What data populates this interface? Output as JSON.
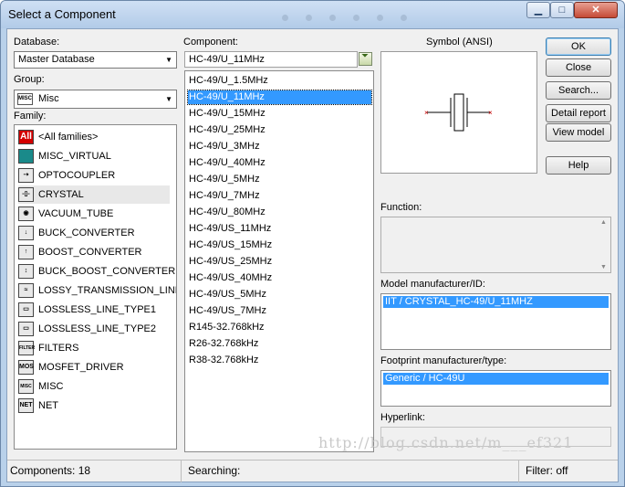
{
  "window": {
    "title": "Select a Component"
  },
  "database": {
    "label": "Database:",
    "value": "Master Database"
  },
  "group": {
    "label": "Group:",
    "value": "Misc",
    "icon_text": "MISC"
  },
  "family": {
    "label": "Family:",
    "items": [
      {
        "label": "<All families>",
        "icon": "all-families-icon",
        "icon_text": "All",
        "icon_color": "#d40000"
      },
      {
        "label": "MISC_VIRTUAL",
        "icon": "misc-virtual-icon",
        "icon_text": "",
        "icon_color": "#1a8a8a"
      },
      {
        "label": "OPTOCOUPLER",
        "icon": "optocoupler-icon",
        "icon_text": "⇢",
        "icon_color": "#e8e8e8"
      },
      {
        "label": "CRYSTAL",
        "icon": "crystal-icon",
        "icon_text": "-▯-",
        "icon_color": "#e8e8e8"
      },
      {
        "label": "VACUUM_TUBE",
        "icon": "vacuum-tube-icon",
        "icon_text": "◉",
        "icon_color": "#e8e8e8"
      },
      {
        "label": "BUCK_CONVERTER",
        "icon": "buck-converter-icon",
        "icon_text": "↓",
        "icon_color": "#e8e8e8"
      },
      {
        "label": "BOOST_CONVERTER",
        "icon": "boost-converter-icon",
        "icon_text": "↑",
        "icon_color": "#e8e8e8"
      },
      {
        "label": "BUCK_BOOST_CONVERTER",
        "icon": "buck-boost-converter-icon",
        "icon_text": "↕",
        "icon_color": "#e8e8e8"
      },
      {
        "label": "LOSSY_TRANSMISSION_LINE",
        "icon": "lossy-transmission-line-icon",
        "icon_text": "≈",
        "icon_color": "#e8e8e8"
      },
      {
        "label": "LOSSLESS_LINE_TYPE1",
        "icon": "lossless-line-type1-icon",
        "icon_text": "▭",
        "icon_color": "#e8e8e8"
      },
      {
        "label": "LOSSLESS_LINE_TYPE2",
        "icon": "lossless-line-type2-icon",
        "icon_text": "▭",
        "icon_color": "#e8e8e8"
      },
      {
        "label": "FILTERS",
        "icon": "filters-icon",
        "icon_text": "FILTER",
        "icon_color": "#e8e8e8"
      },
      {
        "label": "MOSFET_DRIVER",
        "icon": "mosfet-driver-icon",
        "icon_text": "MOS",
        "icon_color": "#e8e8e8"
      },
      {
        "label": "MISC",
        "icon": "misc-icon",
        "icon_text": "MISC",
        "icon_color": "#e8e8e8"
      },
      {
        "label": "NET",
        "icon": "net-icon",
        "icon_text": "NET",
        "icon_color": "#e8e8e8"
      }
    ]
  },
  "component": {
    "label": "Component:",
    "value": "HC-49/U_11MHz",
    "items": [
      "HC-49/U_1.5MHz",
      "HC-49/U_11MHz",
      "HC-49/U_15MHz",
      "HC-49/U_25MHz",
      "HC-49/U_3MHz",
      "HC-49/U_40MHz",
      "HC-49/U_5MHz",
      "HC-49/U_7MHz",
      "HC-49/U_80MHz",
      "HC-49/US_11MHz",
      "HC-49/US_15MHz",
      "HC-49/US_25MHz",
      "HC-49/US_40MHz",
      "HC-49/US_5MHz",
      "HC-49/US_7MHz",
      "R145-32.768kHz",
      "R26-32.768kHz",
      "R38-32.768kHz"
    ],
    "selected_index": 1
  },
  "symbol": {
    "label": "Symbol (ANSI)"
  },
  "function": {
    "label": "Function:"
  },
  "model": {
    "label": "Model manufacturer/ID:",
    "items": [
      "IIT / CRYSTAL_HC-49/U_11MHZ"
    ]
  },
  "footprint": {
    "label": "Footprint manufacturer/type:",
    "items": [
      "Generic / HC-49U"
    ]
  },
  "hyperlink": {
    "label": "Hyperlink:"
  },
  "buttons": {
    "ok": "OK",
    "close": "Close",
    "search": "Search...",
    "detail": "Detail report",
    "view_model": "View model",
    "help": "Help"
  },
  "status": {
    "components": "Components: 18",
    "searching": "Searching:",
    "filter": "Filter: off"
  },
  "watermark": "http://blog.csdn.net/m___ef321",
  "colors": {
    "selection": "#3399ff",
    "frame": "#b9d1ea",
    "close_button": "#c54a35"
  }
}
